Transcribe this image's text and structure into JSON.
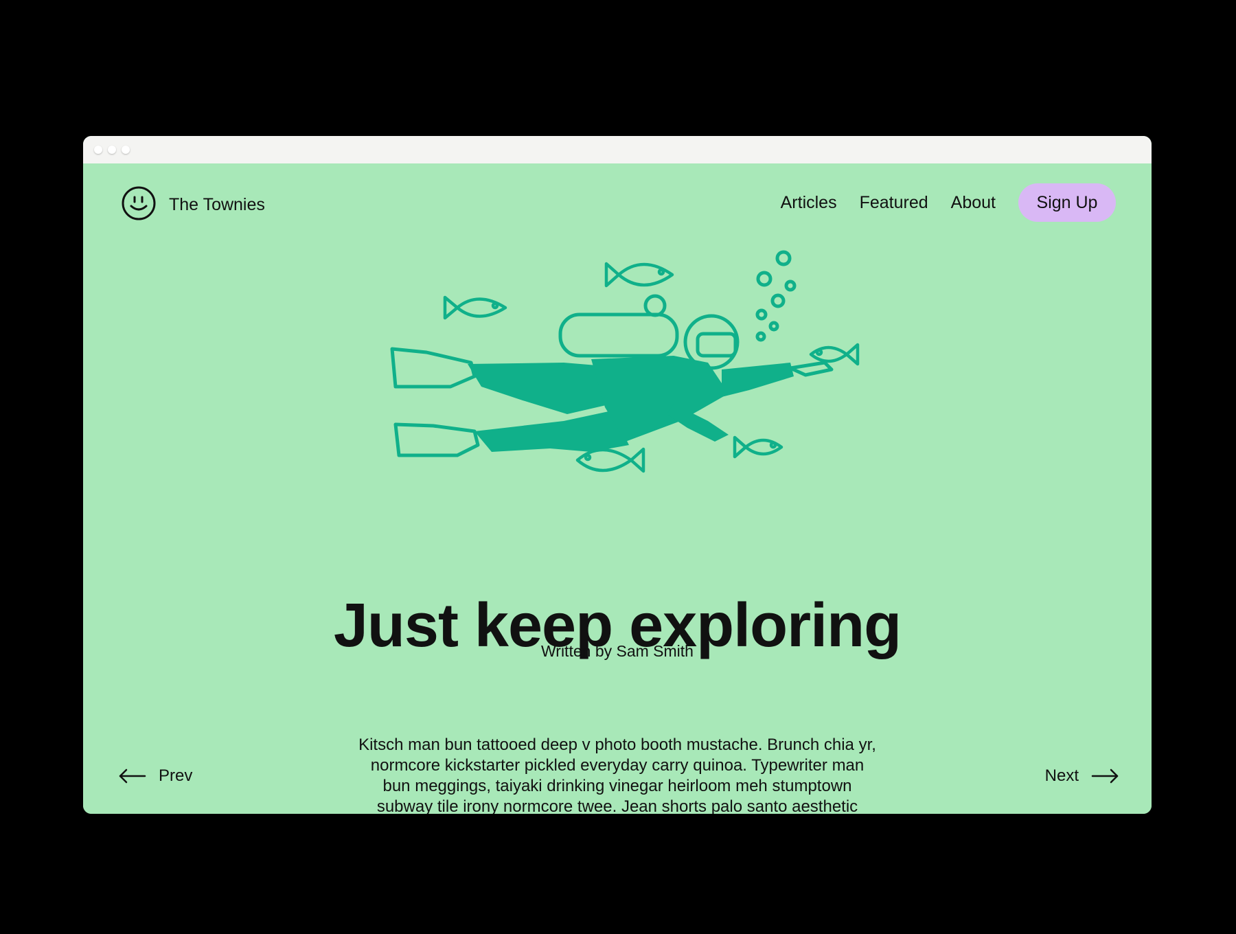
{
  "colors": {
    "page_background": "#a8e8b8",
    "illustration": "#10b08a",
    "signup_background": "#d9b8f5",
    "text": "#111111"
  },
  "window": {
    "controls": [
      "window-dot",
      "window-dot",
      "window-dot"
    ]
  },
  "brand": {
    "logo_icon": "smiley-face-icon",
    "name": "The Townies"
  },
  "nav": {
    "links": [
      "Articles",
      "Featured",
      "About"
    ],
    "signup_label": "Sign Up"
  },
  "hero": {
    "illustration": "scuba-diver-with-fish-illustration"
  },
  "article": {
    "title": "Just keep exploring",
    "byline": "Written by Sam Smith",
    "body": "Kitsch man bun tattooed deep v photo booth mustache. Brunch chia yr, normcore kickstarter pickled everyday carry quinoa. Typewriter man bun meggings, taiyaki drinking vinegar heirloom meh stumptown subway tile irony normcore twee. Jean shorts palo santo aesthetic venmo godard hashtag portland tousled bushwick"
  },
  "pagination": {
    "prev_label": "Prev",
    "prev_icon": "arrow-left-icon",
    "next_label": "Next",
    "next_icon": "arrow-right-icon"
  }
}
